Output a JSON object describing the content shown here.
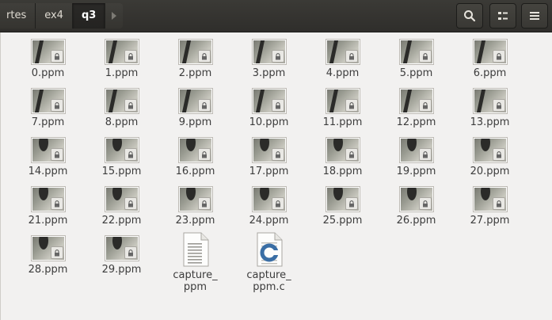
{
  "breadcrumb": {
    "items": [
      "rtes",
      "ex4",
      "q3"
    ]
  },
  "header": {
    "search_icon": "search-icon",
    "view_icon": "view-options-icon",
    "menu_icon": "hamburger-menu-icon"
  },
  "files": [
    {
      "name": "0.ppm",
      "type": "image"
    },
    {
      "name": "1.ppm",
      "type": "image"
    },
    {
      "name": "2.ppm",
      "type": "image"
    },
    {
      "name": "3.ppm",
      "type": "image"
    },
    {
      "name": "4.ppm",
      "type": "image"
    },
    {
      "name": "5.ppm",
      "type": "image"
    },
    {
      "name": "6.ppm",
      "type": "image"
    },
    {
      "name": "7.ppm",
      "type": "image"
    },
    {
      "name": "8.ppm",
      "type": "image"
    },
    {
      "name": "9.ppm",
      "type": "image"
    },
    {
      "name": "10.ppm",
      "type": "image"
    },
    {
      "name": "11.ppm",
      "type": "image"
    },
    {
      "name": "12.ppm",
      "type": "image"
    },
    {
      "name": "13.ppm",
      "type": "image"
    },
    {
      "name": "14.ppm",
      "type": "image"
    },
    {
      "name": "15.ppm",
      "type": "image"
    },
    {
      "name": "16.ppm",
      "type": "image"
    },
    {
      "name": "17.ppm",
      "type": "image"
    },
    {
      "name": "18.ppm",
      "type": "image"
    },
    {
      "name": "19.ppm",
      "type": "image"
    },
    {
      "name": "20.ppm",
      "type": "image"
    },
    {
      "name": "21.ppm",
      "type": "image"
    },
    {
      "name": "22.ppm",
      "type": "image"
    },
    {
      "name": "23.ppm",
      "type": "image"
    },
    {
      "name": "24.ppm",
      "type": "image"
    },
    {
      "name": "25.ppm",
      "type": "image"
    },
    {
      "name": "26.ppm",
      "type": "image"
    },
    {
      "name": "27.ppm",
      "type": "image"
    },
    {
      "name": "28.ppm",
      "type": "image"
    },
    {
      "name": "29.ppm",
      "type": "image"
    },
    {
      "name": "capture_\nppm",
      "type": "executable"
    },
    {
      "name": "capture_\nppm.c",
      "type": "c-source"
    }
  ],
  "colors": {
    "header_bg": "#2f2e2b",
    "content_bg": "#f2f1f0",
    "label_text": "#3c3c3c"
  }
}
